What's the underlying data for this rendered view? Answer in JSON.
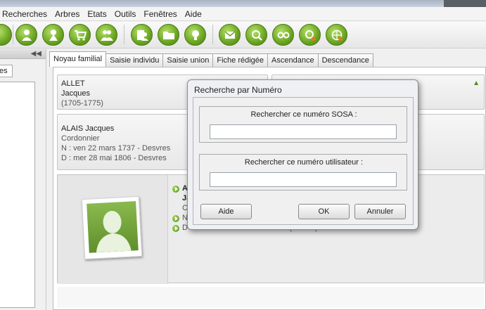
{
  "menu": [
    "Recherches",
    "Arbres",
    "Etats",
    "Outils",
    "Fenêtres",
    "Aide"
  ],
  "toolbar": {
    "icons": [
      "person-icon",
      "woman-icon",
      "cart-icon",
      "couple-icon",
      "document-person-icon",
      "folder-icon",
      "lightbulb-icon",
      "mail-icon",
      "search-icon",
      "glasses-icon",
      "magnifier-globe-icon",
      "globe-icon"
    ]
  },
  "left_panel": {
    "tab_label": "es"
  },
  "tabs": [
    "Noyau familial",
    "Saisie individu",
    "Saisie union",
    "Fiche rédigée",
    "Ascendance",
    "Descendance"
  ],
  "father_card": {
    "surname": "ALLET",
    "firstname": "Jacques",
    "dates": "(1705-1775)"
  },
  "person_card": {
    "name": "ALAIS Jacques",
    "occupation": "Cordonnier",
    "birth": "N : ven 22 mars 1737 - Desvres",
    "death": "D : mer 28 mai 1806 - Desvres"
  },
  "main_person": {
    "name_fragment": "Al",
    "firstname_fragment": "Ja",
    "occupation_fragment": "Co",
    "birth_fragment": "N",
    "death_partial": "D : ven 5 mars 1851 - Desvres (75 ans)"
  },
  "dialog": {
    "title": "Recherche par Numéro",
    "sosa_label": "Rechercher ce numéro SOSA :",
    "sosa_value": "",
    "user_label": "Rechercher ce numéro utilisateur :",
    "user_value": "",
    "help_button": "Aide",
    "ok_button": "OK",
    "cancel_button": "Annuler"
  },
  "colors": {
    "accent_green": "#6aa421",
    "dialog_bg": "#eef0f3"
  }
}
